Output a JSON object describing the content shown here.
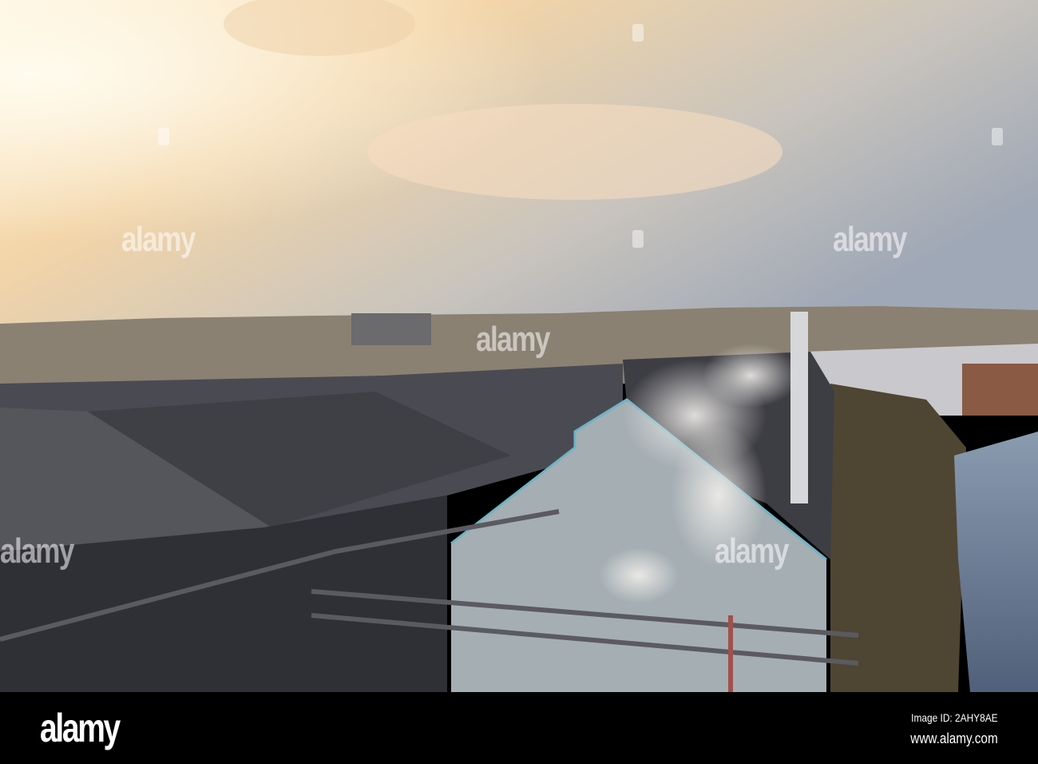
{
  "photo": {
    "subject": "Industrial steelworks roofs with smoke and river at sunset",
    "watermark": "alamy"
  },
  "footer": {
    "logo": "alamy",
    "image_id": "Image ID: 2AHY8AE",
    "url": "www.alamy.com"
  }
}
